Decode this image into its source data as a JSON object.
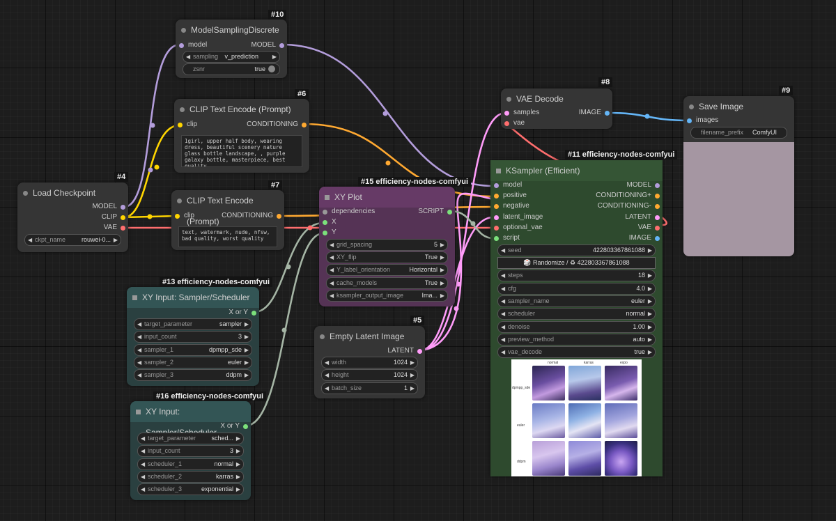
{
  "colors": {
    "model": "#b39ddb",
    "clip": "#ffd500",
    "vae": "#ff6e6e",
    "conditioning": "#ffa931",
    "latent": "#ff9cf9",
    "image": "#64b5f6",
    "script": "#7be07b",
    "dependencies": "#999999"
  },
  "nodes": {
    "model_sampling": {
      "id": "#10",
      "title": "ModelSamplingDiscrete",
      "in_model": "model",
      "out_model": "MODEL",
      "sampling_label": "sampling",
      "sampling_value": "v_prediction",
      "zsnr_label": "zsnr",
      "zsnr_value": "true"
    },
    "clip_pos": {
      "id": "#6",
      "title": "CLIP Text Encode (Prompt)",
      "in_clip": "clip",
      "out_cond": "CONDITIONING",
      "text": "1girl, upper half body, wearing dress, beautiful scenery nature glass bottle landscape, , purple galaxy bottle, masterpiece, best quality"
    },
    "clip_neg": {
      "id": "#7",
      "title": "CLIP Text Encode (Prompt)",
      "in_clip": "clip",
      "out_cond": "CONDITIONING",
      "text": "text, watermark, nude, nfsw, bad quality, worst quality"
    },
    "load_ckpt": {
      "id": "#4",
      "title": "Load Checkpoint",
      "out_model": "MODEL",
      "out_clip": "CLIP",
      "out_vae": "VAE",
      "ckpt_label": "ckpt_name",
      "ckpt_value": "rouwei-0..."
    },
    "xy_plot": {
      "id": "#15 efficiency-nodes-comfyui",
      "title": "XY Plot",
      "in_dependencies": "dependencies",
      "in_x": "X",
      "in_y": "Y",
      "out_script": "SCRIPT",
      "widgets": [
        {
          "label": "grid_spacing",
          "value": "5"
        },
        {
          "label": "XY_flip",
          "value": "True"
        },
        {
          "label": "Y_label_orientation",
          "value": "Horizontal"
        },
        {
          "label": "cache_models",
          "value": "True"
        },
        {
          "label": "ksampler_output_image",
          "value": "Ima..."
        }
      ]
    },
    "xy_input_13": {
      "id": "#13 efficiency-nodes-comfyui",
      "title": "XY Input: Sampler/Scheduler",
      "out": "X or Y",
      "widgets": [
        {
          "label": "target_parameter",
          "value": "sampler"
        },
        {
          "label": "input_count",
          "value": "3"
        },
        {
          "label": "sampler_1",
          "value": "dpmpp_sde"
        },
        {
          "label": "sampler_2",
          "value": "euler"
        },
        {
          "label": "sampler_3",
          "value": "ddpm"
        }
      ]
    },
    "xy_input_16": {
      "id": "#16 efficiency-nodes-comfyui",
      "title": "XY Input: Sampler/Scheduler",
      "out": "X or Y",
      "widgets": [
        {
          "label": "target_parameter",
          "value": "sched..."
        },
        {
          "label": "input_count",
          "value": "3"
        },
        {
          "label": "scheduler_1",
          "value": "normal"
        },
        {
          "label": "scheduler_2",
          "value": "karras"
        },
        {
          "label": "scheduler_3",
          "value": "exponential"
        }
      ]
    },
    "empty_latent": {
      "id": "#5",
      "title": "Empty Latent Image",
      "out": "LATENT",
      "widgets": [
        {
          "label": "width",
          "value": "1024"
        },
        {
          "label": "height",
          "value": "1024"
        },
        {
          "label": "batch_size",
          "value": "1"
        }
      ]
    },
    "vae_decode": {
      "id": "#8",
      "title": "VAE Decode",
      "in_samples": "samples",
      "in_vae": "vae",
      "out_image": "IMAGE"
    },
    "save_image": {
      "id": "#9",
      "title": "Save Image",
      "in_images": "images",
      "prefix_label": "filename_prefix",
      "prefix_value": "ComfyUI"
    },
    "ksampler": {
      "id": "#11 efficiency-nodes-comfyui",
      "title": "KSampler (Efficient)",
      "inputs": [
        "model",
        "positive",
        "negative",
        "latent_image",
        "optional_vae",
        "script"
      ],
      "outputs": [
        "MODEL",
        "CONDITIONING+",
        "CONDITIONING-",
        "LATENT",
        "VAE",
        "IMAGE"
      ],
      "seed_label": "seed",
      "seed_value": "422803367861088",
      "randomize_label": "🎲 Randomize / ♻ 422803367861088",
      "widgets": [
        {
          "label": "steps",
          "value": "18"
        },
        {
          "label": "cfg",
          "value": "4.0"
        },
        {
          "label": "sampler_name",
          "value": "euler"
        },
        {
          "label": "scheduler",
          "value": "normal"
        },
        {
          "label": "denoise",
          "value": "1.00"
        },
        {
          "label": "preview_method",
          "value": "auto"
        },
        {
          "label": "vae_decode",
          "value": "true"
        }
      ],
      "grid_col_labels": [
        "normal",
        "karras",
        "expo"
      ],
      "grid_row_labels": [
        "dpmpp_sde",
        "euler",
        "ddpm"
      ]
    }
  }
}
